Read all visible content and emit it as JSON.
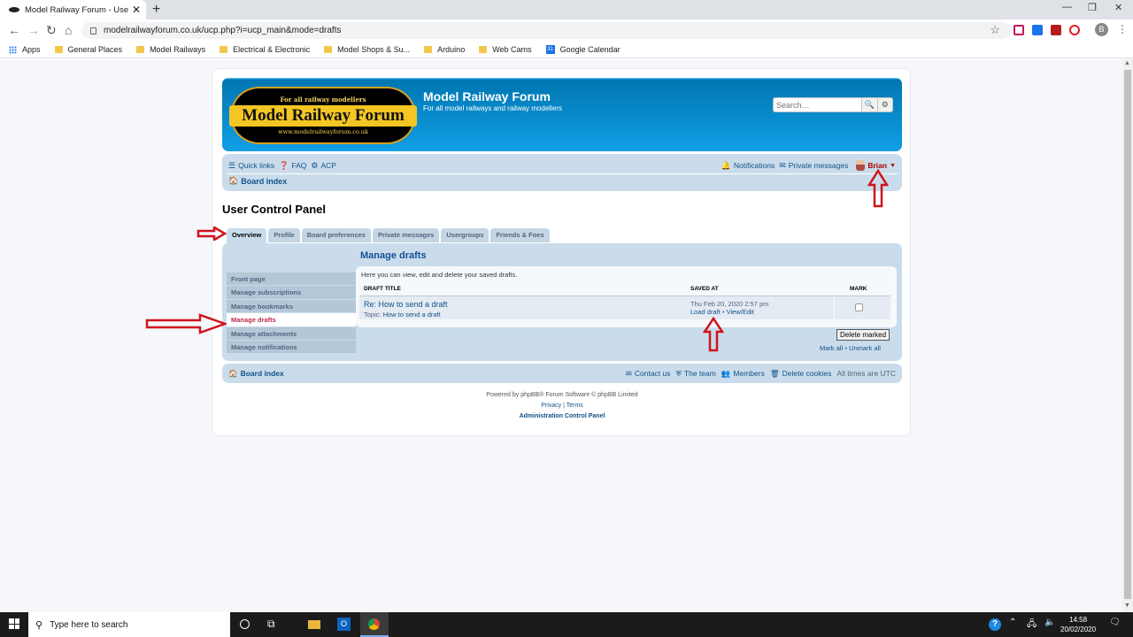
{
  "browser": {
    "tab_title": "Model Railway Forum - User Con",
    "url": "modelrailwayforum.co.uk/ucp.php?i=ucp_main&mode=drafts",
    "profile_initial": "B",
    "bookmarks": [
      "Apps",
      "General Places",
      "Model Railways",
      "Electrical & Electronic",
      "Model Shops & Su...",
      "Arduino",
      "Web Cams",
      "Google Calendar"
    ]
  },
  "site": {
    "logo_tagline_top": "For all railway modellers",
    "logo_main": "Model Railway Forum",
    "logo_tagline_bottom": "www.modelrailwayforum.co.uk",
    "name": "Model Railway Forum",
    "description": "For all model railways and railway modellers",
    "search_placeholder": "Search…"
  },
  "navbar": {
    "quick_links": "Quick links",
    "faq": "FAQ",
    "acp": "ACP",
    "notifications": "Notifications",
    "private_messages": "Private messages",
    "username": "Brian",
    "board_index": "Board index"
  },
  "ucp": {
    "title": "User Control Panel",
    "tabs": [
      "Overview",
      "Profile",
      "Board preferences",
      "Private messages",
      "Usergroups",
      "Friends & Foes"
    ],
    "active_tab": "Overview",
    "menu": [
      "Front page",
      "Manage subscriptions",
      "Manage bookmarks",
      "Manage drafts",
      "Manage attachments",
      "Manage notifications"
    ],
    "active_menu": "Manage drafts",
    "heading": "Manage drafts",
    "help": "Here you can view, edit and delete your saved drafts.",
    "columns": {
      "title": "Draft title",
      "saved": "Saved at",
      "mark": "Mark"
    },
    "drafts": [
      {
        "title": "Re: How to send a draft",
        "topic_prefix": "Topic:",
        "topic": "How to send a draft",
        "saved_at": "Thu Feb 20, 2020 2:57 pm",
        "load": "Load draft",
        "sep": "•",
        "view_edit": "View/Edit"
      }
    ],
    "delete_marked": "Delete marked",
    "mark_all": "Mark all",
    "unmark_all": "Unmark all",
    "bullet": "•"
  },
  "footer": {
    "board_index": "Board index",
    "contact": "Contact us",
    "team": "The team",
    "members": "Members",
    "delete_cookies": "Delete cookies",
    "timezone": "All times are UTC",
    "powered": "Powered by phpBB® Forum Software © phpBB Limited",
    "privacy": "Privacy",
    "pipe": "|",
    "terms": "Terms",
    "acp": "Administration Control Panel"
  },
  "taskbar": {
    "search_placeholder": "Type here to search",
    "time": "14:58",
    "date": "20/02/2020"
  },
  "colors": {
    "arrow_red": "#d0131d",
    "header_blue": "#12a3eb",
    "nav_bg": "#cadceb",
    "active_menu_text": "#bc2a4d"
  }
}
